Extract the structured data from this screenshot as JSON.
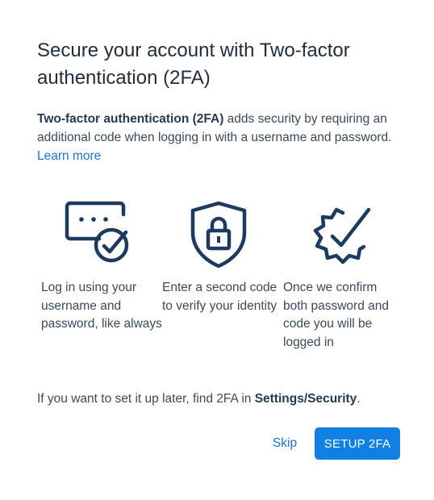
{
  "dialog": {
    "title": "Secure your account with Two-factor authentication (2FA)",
    "intro_bold": "Two-factor authentication (2FA)",
    "intro_rest": " adds security by requiring an additional code when logging in with a username and password.",
    "learn_more": "Learn more",
    "steps": [
      {
        "icon": "chat-check-icon",
        "text": "Log in using your username and password, like always"
      },
      {
        "icon": "shield-lock-icon",
        "text": "Enter a second code to verify your identity"
      },
      {
        "icon": "badge-check-icon",
        "text": "Once we confirm both password and code you will be logged in"
      }
    ],
    "later_text": "If you want to set it up later, find 2FA in ",
    "later_bold": "Settings/Security",
    "later_end": ".",
    "skip_label": "Skip",
    "setup_label": "SETUP 2FA"
  },
  "colors": {
    "icon": "#1f3a60",
    "link": "#1a73d1",
    "primary_button": "#1180e3"
  }
}
